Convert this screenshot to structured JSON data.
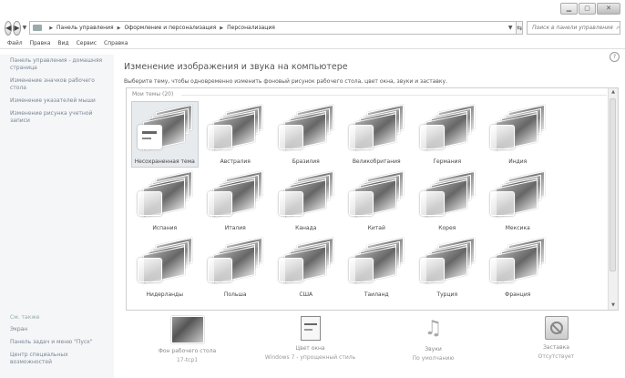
{
  "toolbar": {
    "address": [
      "Панель управления",
      "Оформление и персонализация",
      "Персонализация"
    ],
    "search_placeholder": "Поиск в панели управления"
  },
  "menu": [
    "Файл",
    "Правка",
    "Вид",
    "Сервис",
    "Справка"
  ],
  "left": {
    "links": [
      "Панель управления - домашняя страница",
      "Изменение значков рабочего стола",
      "Изменение указателей мыши",
      "Изменение рисунка учетной записи"
    ],
    "see_also": "См. также",
    "bottom_links": [
      "Экран",
      "Панель задач и меню \"Пуск\"",
      "Центр специальных возможностей"
    ]
  },
  "main": {
    "title": "Изменение изображения и звука на компьютере",
    "subtitle": "Выберите тему, чтобы одновременно изменить фоновый рисунок рабочего стола, цвет окна, звуки и заставку.",
    "group_header": "Мои темы (20)",
    "themes": [
      "Несохраненная тема",
      "Австралия",
      "Бразилия",
      "Великобритания",
      "Германия",
      "Индия",
      "Испания",
      "Италия",
      "Канада",
      "Китай",
      "Корея",
      "Мексика",
      "Нидерланды",
      "Польша",
      "США",
      "Таиланд",
      "Турция",
      "Франция"
    ]
  },
  "bottom": [
    {
      "label": "Фон рабочего стола",
      "value": "17-tcp1",
      "icon": "desktop-background-icon"
    },
    {
      "label": "Цвет окна",
      "value": "Windows 7 - упрощенный стиль",
      "icon": "window-color-icon"
    },
    {
      "label": "Звуки",
      "value": "По умолчанию",
      "icon": "sounds-icon"
    },
    {
      "label": "Заставка",
      "value": "Отсутствует",
      "icon": "screensaver-icon"
    }
  ]
}
